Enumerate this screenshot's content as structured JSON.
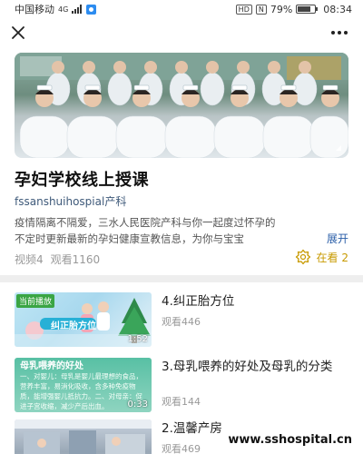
{
  "status_bar": {
    "carrier": "中国移动",
    "network": "4G",
    "hd": "HD",
    "nfc": "N",
    "battery_percent": "79%",
    "battery_level": 0.79,
    "time": "08:34"
  },
  "nav": {
    "close_icon": "close-icon",
    "more_icon": "more-dots-icon"
  },
  "course": {
    "title": "孕妇学校线上授课",
    "source": "fssanshuihospial产科",
    "description_line1": "疫情隔离不隔爱，三水人民医院产科与你一起度过怀孕的",
    "description_line2": "不定时更新最新的孕妇健康宣教信息，为你与宝宝",
    "expand_label": "展开",
    "video_count": "视频4",
    "view_count": "观看1160",
    "watching_label": "在看 2"
  },
  "episodes": [
    {
      "badge": "当前播放",
      "thumb_caption": "纠正胎方位",
      "duration": "1:52",
      "title": "4.纠正胎方位",
      "views": "观看446"
    },
    {
      "thumb_caption": "母乳喂养的好处",
      "thumb_text": "一、对婴儿：母乳是婴儿最理想的食品，营养丰富，易消化吸收，含多种免疫物质，能增强婴儿抵抗力。二、对母亲：促进子宫收缩，减少产后出血。",
      "duration": "0:33",
      "title": "3.母乳喂养的好处及母乳的分类",
      "views": "观看144"
    },
    {
      "title": "2.温馨产房",
      "views": "观看469"
    }
  ],
  "watermark": "www.sshospital.cn",
  "colors": {
    "accent_gold": "#c89a00",
    "link_blue": "#2a5ea8",
    "badge_green": "#3aa544"
  }
}
